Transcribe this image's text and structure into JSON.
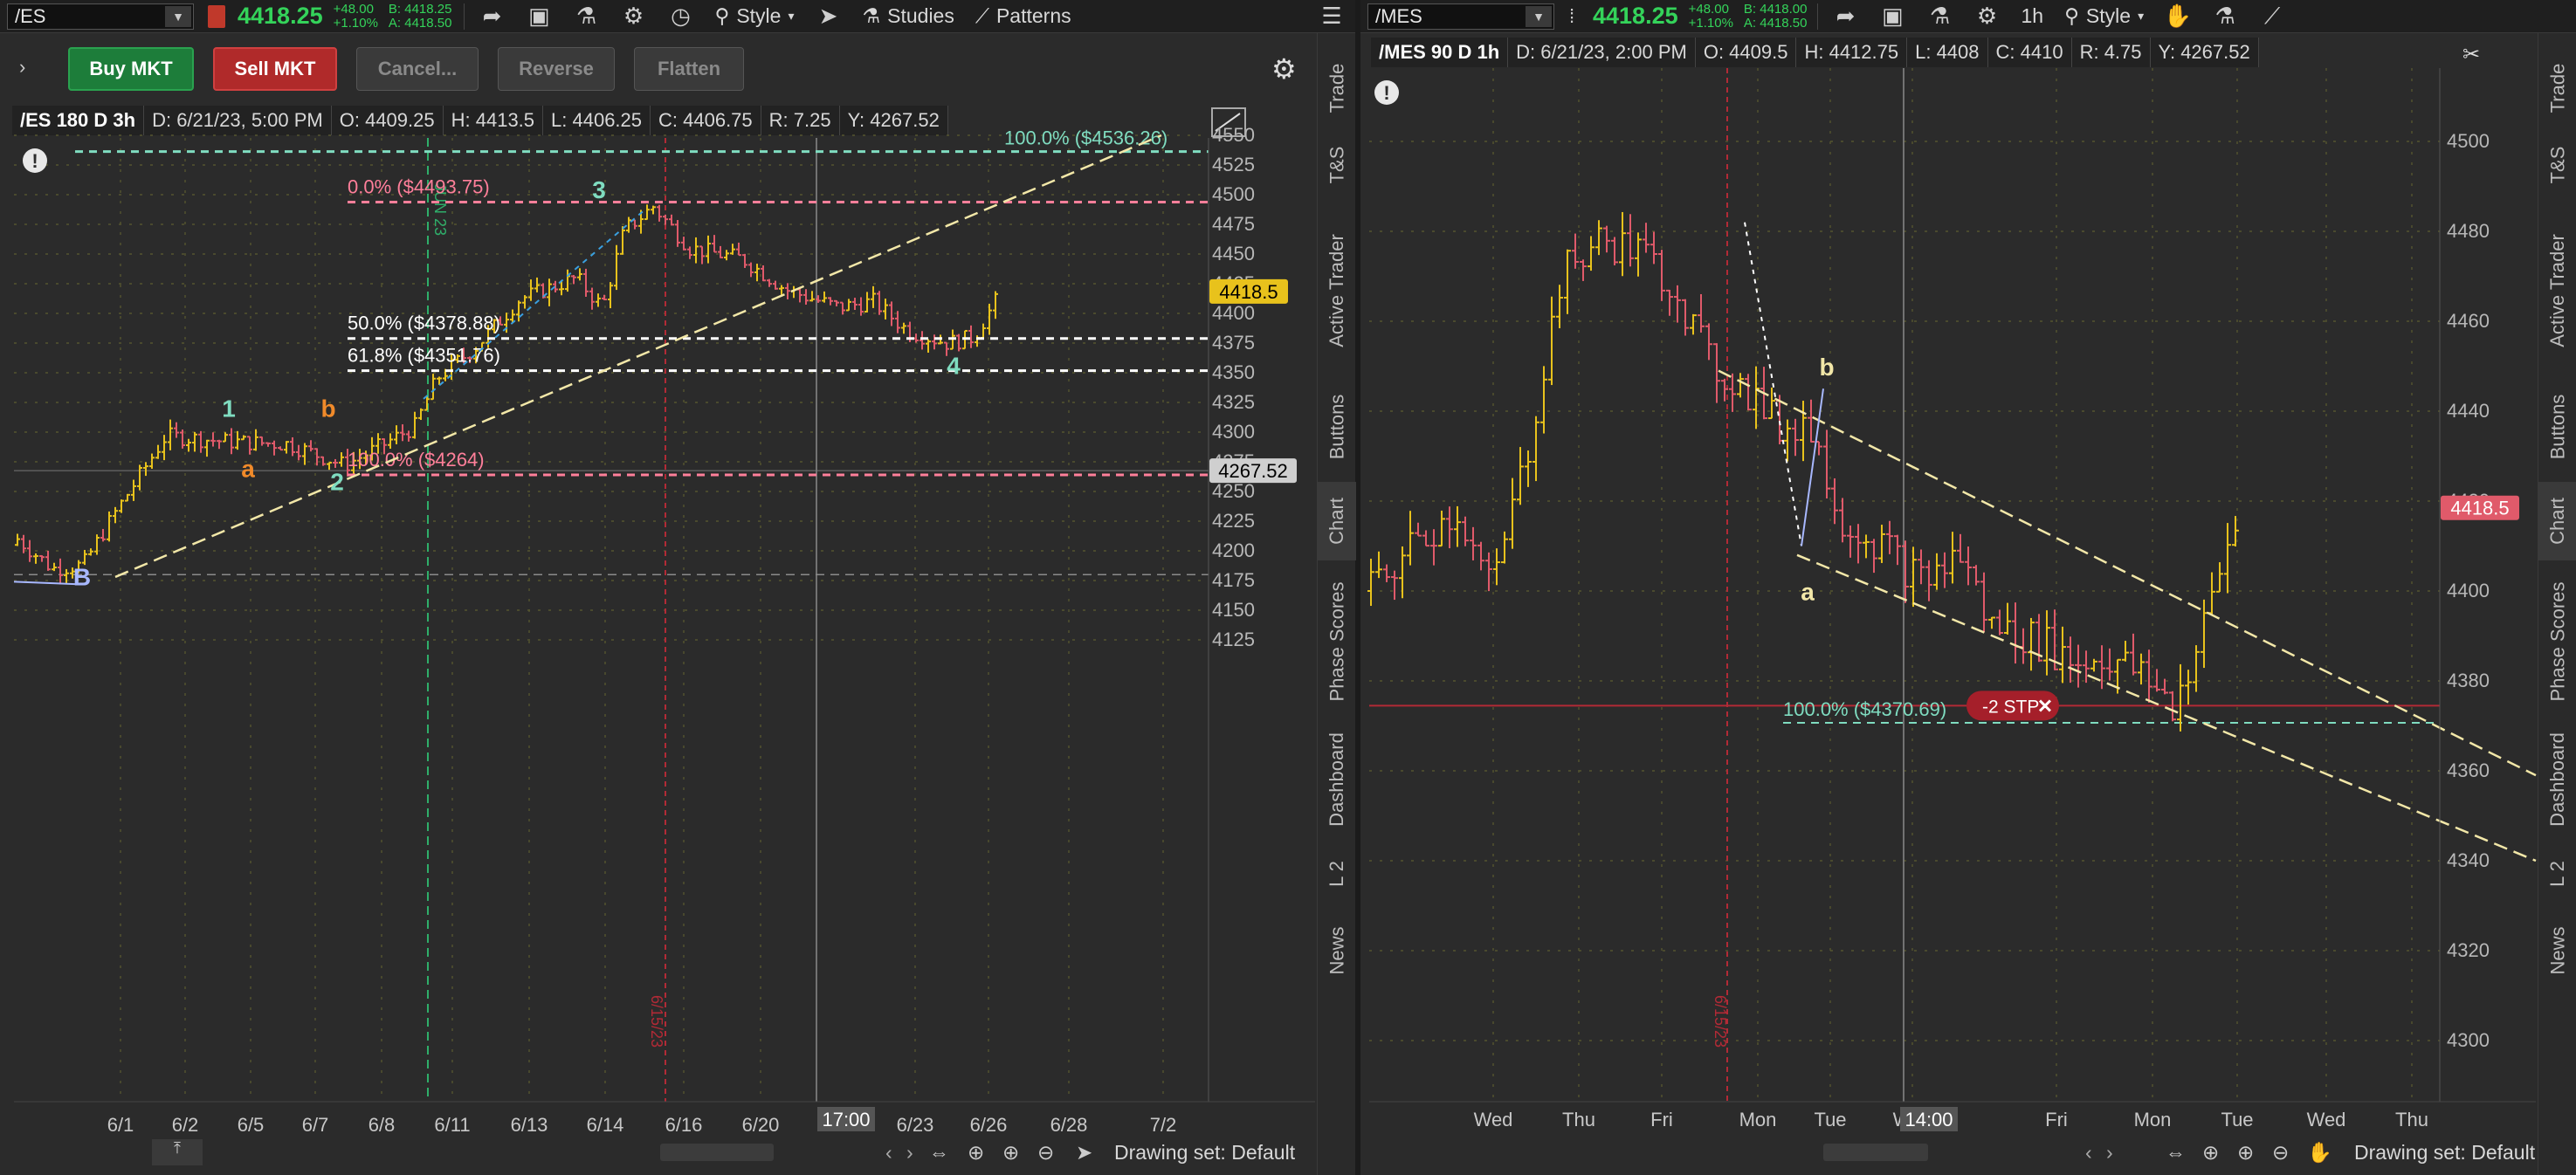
{
  "left": {
    "symbol": "/ES",
    "price": "4418.25",
    "change": "+48.00",
    "change_pct": "+1.10%",
    "bid": "B: 4418.25",
    "ask": "A: 4418.50",
    "toolbar": {
      "style_label": "Style",
      "studies_label": "Studies",
      "patterns_label": "Patterns"
    },
    "trade_buttons": {
      "buy": "Buy MKT",
      "sell": "Sell MKT",
      "cancel": "Cancel...",
      "reverse": "Reverse",
      "flatten": "Flatten"
    },
    "info": {
      "title": "/ES 180 D 3h",
      "date": "D: 6/21/23, 5:00 PM",
      "open": "O: 4409.25",
      "high": "H: 4413.5",
      "low": "L: 4406.25",
      "close": "C: 4406.75",
      "range": "R: 7.25",
      "y": "Y: 4267.52"
    },
    "y_ticks": [
      "4550",
      "4525",
      "4500",
      "4475",
      "4450",
      "4425",
      "4400",
      "4375",
      "4350",
      "4325",
      "4300",
      "4275",
      "4250",
      "4225",
      "4200",
      "4175",
      "4150",
      "4125"
    ],
    "x_ticks": [
      "6/1",
      "6/2",
      "6/5",
      "6/7",
      "6/8",
      "6/11",
      "6/13",
      "6/14",
      "6/16",
      "6/20",
      "6/23",
      "6/26",
      "6/28",
      "7/2"
    ],
    "x_cursor": "17:00",
    "price_marker": "4418.5",
    "cursor_marker": "4267.52",
    "fib": {
      "f100": "100.0%  ($4536.26)",
      "f0": "0.0%  ($4493.75)",
      "f50": "50.0%  ($4378.88)",
      "f618": "61.8%  ($4351.76)",
      "f100b": "100.0%  ($4264)"
    },
    "wave_labels": {
      "w1": "1",
      "w2": "2",
      "w3": "3",
      "w4": "4",
      "wa": "a",
      "wb": "b",
      "wB": "B"
    },
    "vline_label_a": "JUN 23",
    "vline_label_b": "6/15/23",
    "drawing_set": "Drawing set: Default",
    "vtabs": [
      "Trade",
      "T&S",
      "Active Trader",
      "Buttons",
      "Chart",
      "Phase Scores",
      "Dashboard",
      "L 2",
      "News"
    ]
  },
  "right": {
    "symbol": "/MES",
    "price": "4418.25",
    "change": "+48.00",
    "change_pct": "+1.10%",
    "bid": "B: 4418.00",
    "ask": "A: 4418.50",
    "toolbar": {
      "interval_label": "1h",
      "style_label": "Style"
    },
    "info": {
      "title": "/MES 90 D 1h",
      "date": "D: 6/21/23, 2:00 PM",
      "open": "O: 4409.5",
      "high": "H: 4412.75",
      "low": "L: 4408",
      "close": "C: 4410",
      "range": "R: 4.75",
      "y": "Y: 4267.52"
    },
    "y_ticks": [
      "4500",
      "4480",
      "4460",
      "4440",
      "4420",
      "4400",
      "4380",
      "4360",
      "4340",
      "4320",
      "4300"
    ],
    "x_ticks": [
      "Wed",
      "Thu",
      "Fri",
      "Mon",
      "Tue",
      "Wed",
      "Fri",
      "Mon",
      "Tue",
      "Wed",
      "Thu"
    ],
    "x_cursor": "14:00",
    "price_marker": "4418.5",
    "fib": {
      "f100": "100.0%  ($4370.69)"
    },
    "stop_label": "-2 STP",
    "wave_labels": {
      "wa": "a",
      "wb": "b"
    },
    "vline_label": "6/15/23",
    "drawing_set": "Drawing set: Default",
    "vtabs": [
      "Trade",
      "T&S",
      "Active Trader",
      "Buttons",
      "Chart",
      "Phase Scores",
      "Dashboard",
      "L 2",
      "News"
    ]
  },
  "colors": {
    "up": "#e8c21c",
    "down": "#e05a6a",
    "green": "#34d35a",
    "fib_red": "#ff7f9a",
    "fib_white": "#ffffff",
    "fib_cyan": "#7fdcc0",
    "trend": "#f2e7a8"
  }
}
